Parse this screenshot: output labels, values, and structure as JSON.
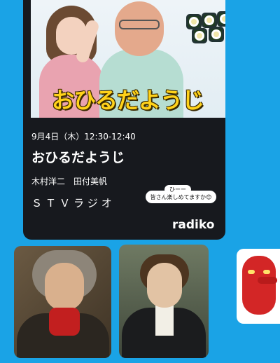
{
  "program": {
    "logo_text": "おひるだようじ",
    "airtime": "9月4日（木）12:30-12:40",
    "title": "おひるだようじ",
    "hosts": "木村洋二　田付美帆",
    "station": "ＳＴＶラジオ",
    "bubble_top": "ひーー",
    "bubble_text": "皆さん楽しめてますか😊",
    "brand": "radiko"
  },
  "colors": {
    "background": "#1aa3e6",
    "card": "#17191e",
    "logo_yellow": "#ffd21a"
  },
  "thumbnails": [
    {
      "name": "beethoven-portrait"
    },
    {
      "name": "schubert-portrait"
    },
    {
      "name": "tengu-mask"
    }
  ]
}
